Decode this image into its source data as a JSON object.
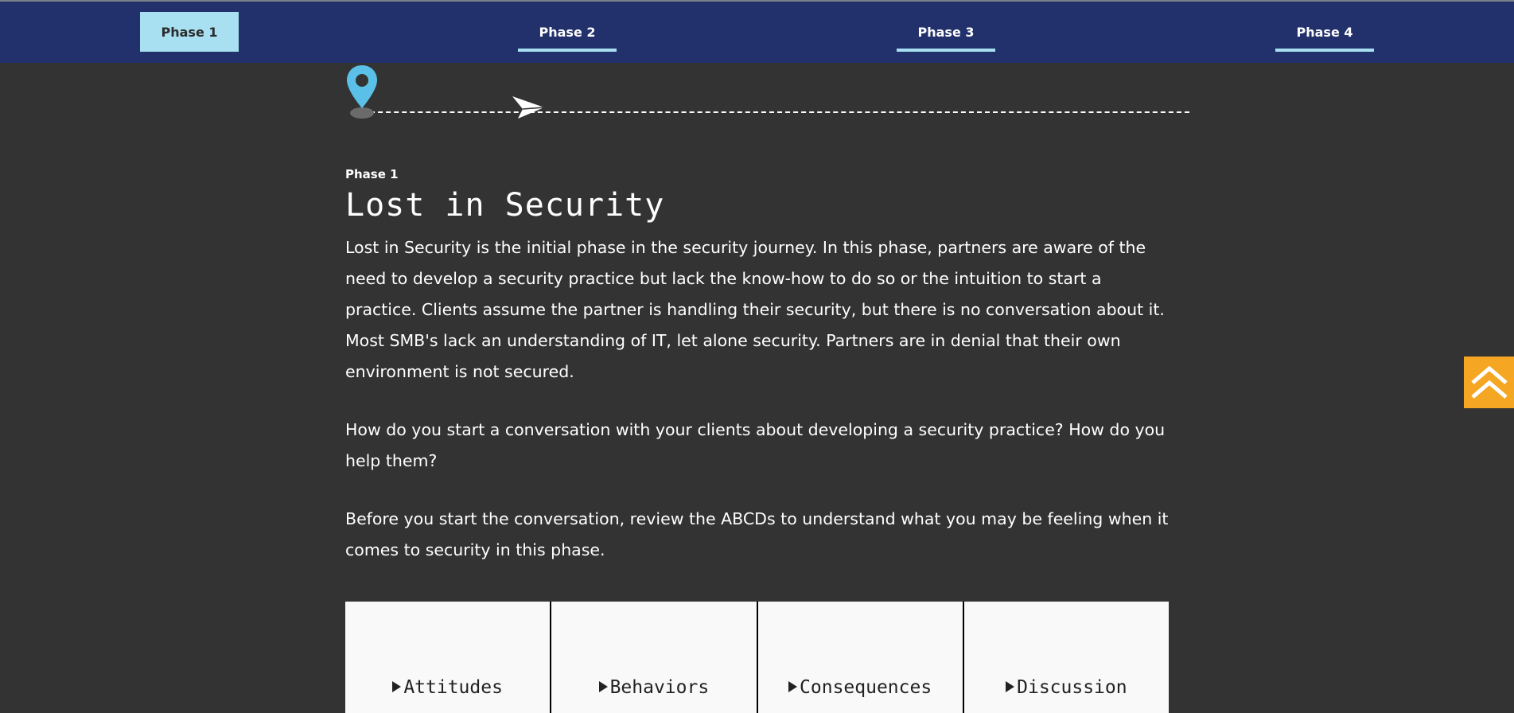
{
  "nav": {
    "tabs": [
      {
        "label": "Phase 1",
        "active": true
      },
      {
        "label": "Phase 2",
        "active": false
      },
      {
        "label": "Phase 3",
        "active": false
      },
      {
        "label": "Phase 4",
        "active": false
      }
    ]
  },
  "journey": {
    "pin_icon": "map-pin-icon",
    "plane_icon": "paper-plane-icon",
    "pin_color": "#5bc0e8"
  },
  "main": {
    "eyebrow": "Phase 1",
    "title": "Lost in Security",
    "paragraphs": [
      "Lost in Security is the initial phase in the security journey. In this phase, partners are aware of the need to develop a security practice but lack the know-how to do so or the intuition to start a practice. Clients assume the partner is handling their security, but there is no conversation about it. Most SMB's lack an understanding of IT, let alone security. Partners are in denial that their own environment is not secured.",
      "How do you start a conversation with your clients about developing a security practice? How do you help them?",
      "Before you start the conversation, review the ABCDs to understand what you may be feeling when it comes to security in this phase."
    ]
  },
  "abcd": {
    "cards": [
      {
        "label": "Attitudes"
      },
      {
        "label": "Behaviors"
      },
      {
        "label": "Consequences"
      },
      {
        "label": "Discussion"
      }
    ]
  },
  "scroll_top": {
    "icon": "double-chevron-up-icon",
    "color": "#f5a623"
  },
  "colors": {
    "background": "#333333",
    "navbar": "#22316b",
    "accent": "#a8dff1"
  }
}
